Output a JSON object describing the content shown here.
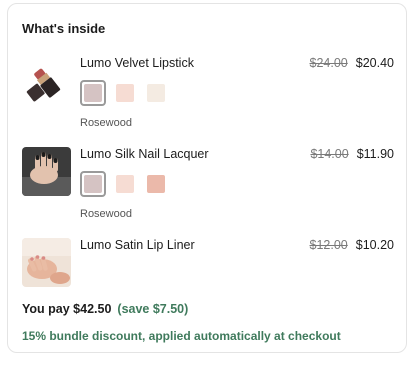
{
  "section": {
    "title": "What's inside"
  },
  "items": [
    {
      "name": "Lumo Velvet Lipstick",
      "old_price": "$24.00",
      "new_price": "$20.40",
      "image_icon": "lipstick-icon",
      "swatches": [
        {
          "color": "#d5c3c3",
          "selected": true
        },
        {
          "color": "#f6dcd3",
          "selected": false
        },
        {
          "color": "#f4ebe2",
          "selected": false
        }
      ],
      "shade": "Rosewood"
    },
    {
      "name": "Lumo Silk Nail Lacquer",
      "old_price": "$14.00",
      "new_price": "$11.90",
      "image_icon": "nail-lacquer-icon",
      "swatches": [
        {
          "color": "#d5c3c3",
          "selected": true
        },
        {
          "color": "#f6dcd3",
          "selected": false
        },
        {
          "color": "#ebb9aa",
          "selected": false
        }
      ],
      "shade": "Rosewood"
    },
    {
      "name": "Lumo Satin Lip Liner",
      "old_price": "$12.00",
      "new_price": "$10.20",
      "image_icon": "lip-liner-icon",
      "swatches": [],
      "shade": ""
    }
  ],
  "summary": {
    "you_pay": "You pay $42.50",
    "savings": "(save $7.50)",
    "discount_note": "15% bundle discount, applied automatically at checkout"
  },
  "colors": {
    "accent_green": "#3f7a5c",
    "border": "#e4e4e4"
  }
}
